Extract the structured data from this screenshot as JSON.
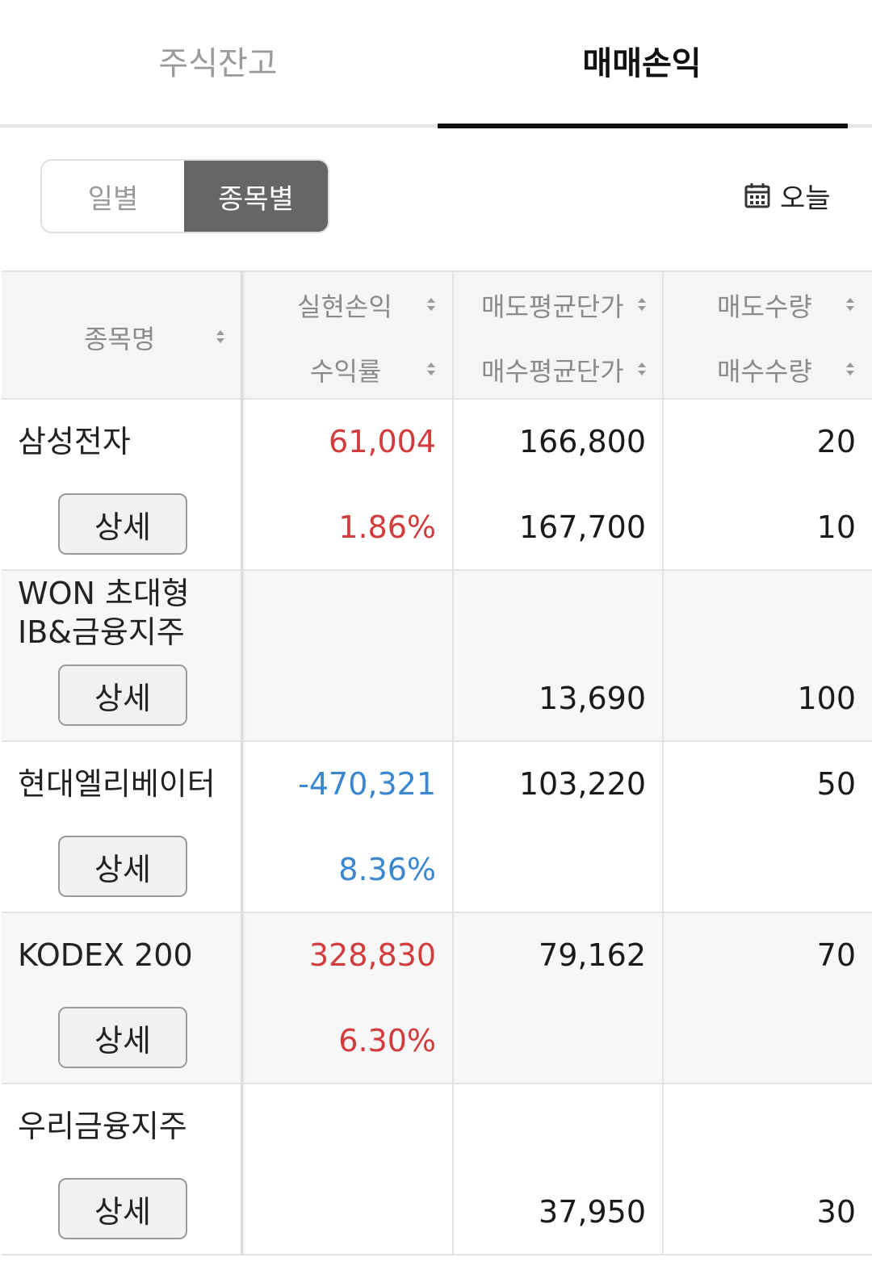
{
  "tabs": [
    {
      "label": "주식잔고",
      "active": false
    },
    {
      "label": "매매손익",
      "active": true
    }
  ],
  "view_toggle": {
    "daily": "일별",
    "by_item": "종목별",
    "selected": "종목별"
  },
  "date_filter": {
    "label": "오늘",
    "icon": "calendar-icon"
  },
  "table": {
    "headers": {
      "name": "종목명",
      "realized_pnl": "실현손익",
      "return_rate": "수익률",
      "avg_sell_price": "매도평균단가",
      "avg_buy_price": "매수평균단가",
      "sell_qty": "매도수량",
      "buy_qty": "매수수량"
    },
    "detail_label": "상세",
    "rows": [
      {
        "name": "삼성전자",
        "pnl": "61,004",
        "rate": "1.86%",
        "sell_price": "166,800",
        "buy_price": "167,700",
        "sell_qty": "20",
        "buy_qty": "10",
        "sign": "positive"
      },
      {
        "name": "WON 초대형 IB&금융지주",
        "name_line1": "WON 초대형",
        "name_line2": "IB&금융지주",
        "pnl": "",
        "rate": "",
        "sell_price": "",
        "buy_price": "13,690",
        "sell_qty": "",
        "buy_qty": "100",
        "sign": "none"
      },
      {
        "name": "현대엘리베이터",
        "pnl": "-470,321",
        "rate": "8.36%",
        "sell_price": "103,220",
        "buy_price": "",
        "sell_qty": "50",
        "buy_qty": "",
        "sign": "negative"
      },
      {
        "name": "KODEX 200",
        "pnl": "328,830",
        "rate": "6.30%",
        "sell_price": "79,162",
        "buy_price": "",
        "sell_qty": "70",
        "buy_qty": "",
        "sign": "positive"
      },
      {
        "name": "우리금융지주",
        "pnl": "",
        "rate": "",
        "sell_price": "",
        "buy_price": "37,950",
        "sell_qty": "",
        "buy_qty": "30",
        "sign": "none"
      }
    ]
  },
  "colors": {
    "profit": "#d23c3c",
    "loss": "#3a87d0",
    "active_tab": "#111111",
    "toggle_selected": "#666666"
  }
}
